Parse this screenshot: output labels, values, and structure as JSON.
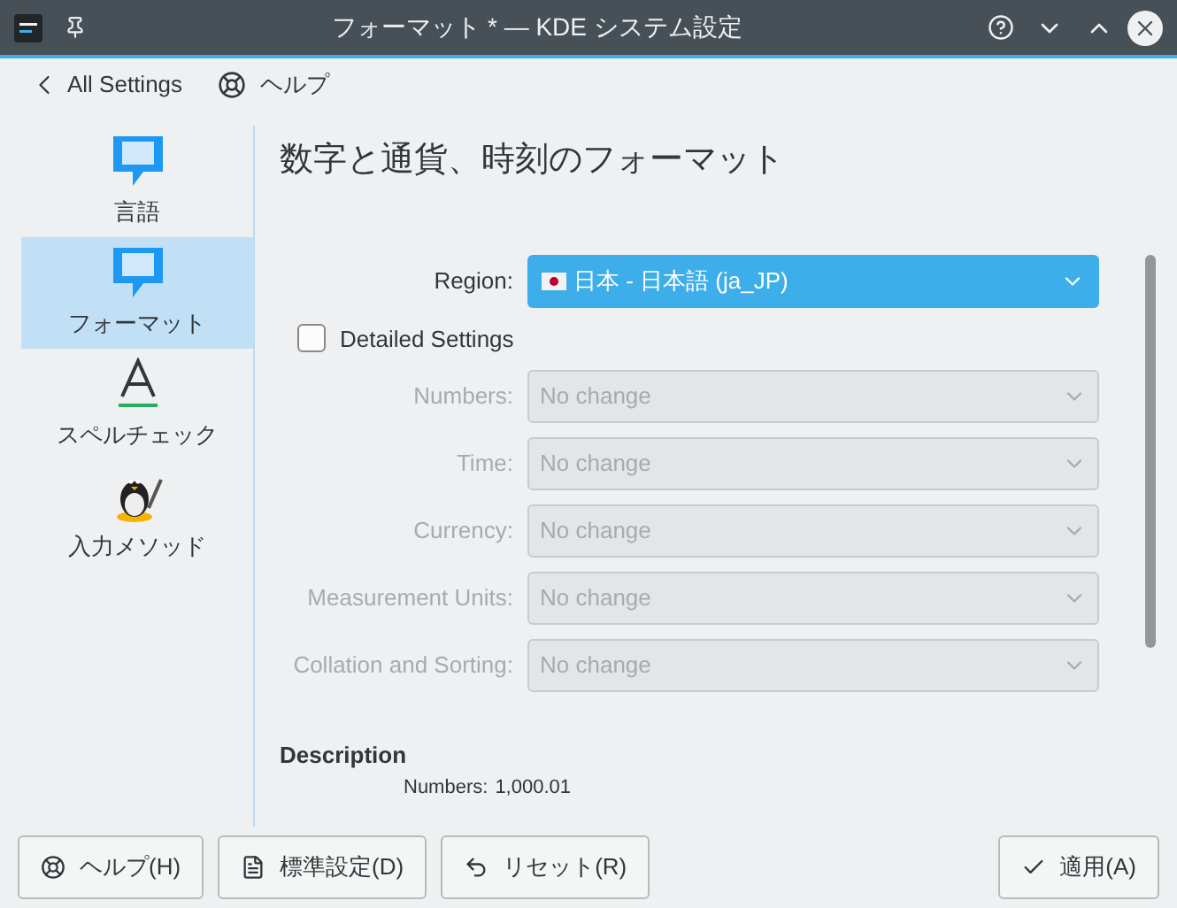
{
  "window": {
    "title": "フォーマット * — KDE システム設定"
  },
  "toolbar": {
    "back": "All Settings",
    "help": "ヘルプ"
  },
  "sidebar": {
    "items": [
      {
        "label": "言語",
        "selected": false,
        "kind": "speech"
      },
      {
        "label": "フォーマット",
        "selected": true,
        "kind": "speech"
      },
      {
        "label": "スペルチェック",
        "selected": false,
        "kind": "spelling"
      },
      {
        "label": "入力メソッド",
        "selected": false,
        "kind": "penguin"
      }
    ]
  },
  "page": {
    "title": "数字と通貨、時刻のフォーマット",
    "region": {
      "label": "Region:",
      "value": "日本 - 日本語 (ja_JP)"
    },
    "detailed_settings": {
      "label": "Detailed Settings",
      "checked": false
    },
    "fields": [
      {
        "label": "Numbers:",
        "value": "No change",
        "disabled": true
      },
      {
        "label": "Time:",
        "value": "No change",
        "disabled": true
      },
      {
        "label": "Currency:",
        "value": "No change",
        "disabled": true
      },
      {
        "label": "Measurement Units:",
        "value": "No change",
        "disabled": true
      },
      {
        "label": "Collation and Sorting:",
        "value": "No change",
        "disabled": true
      }
    ],
    "description": {
      "heading": "Description",
      "rows": [
        {
          "label": "Numbers:",
          "value": "1,000.01"
        }
      ]
    }
  },
  "buttons": [
    {
      "label": "ヘルプ(H)",
      "kind": "help"
    },
    {
      "label": "標準設定(D)",
      "kind": "defaults"
    },
    {
      "label": "リセット(R)",
      "kind": "reset"
    },
    {
      "label": "適用(A)",
      "kind": "apply"
    }
  ]
}
